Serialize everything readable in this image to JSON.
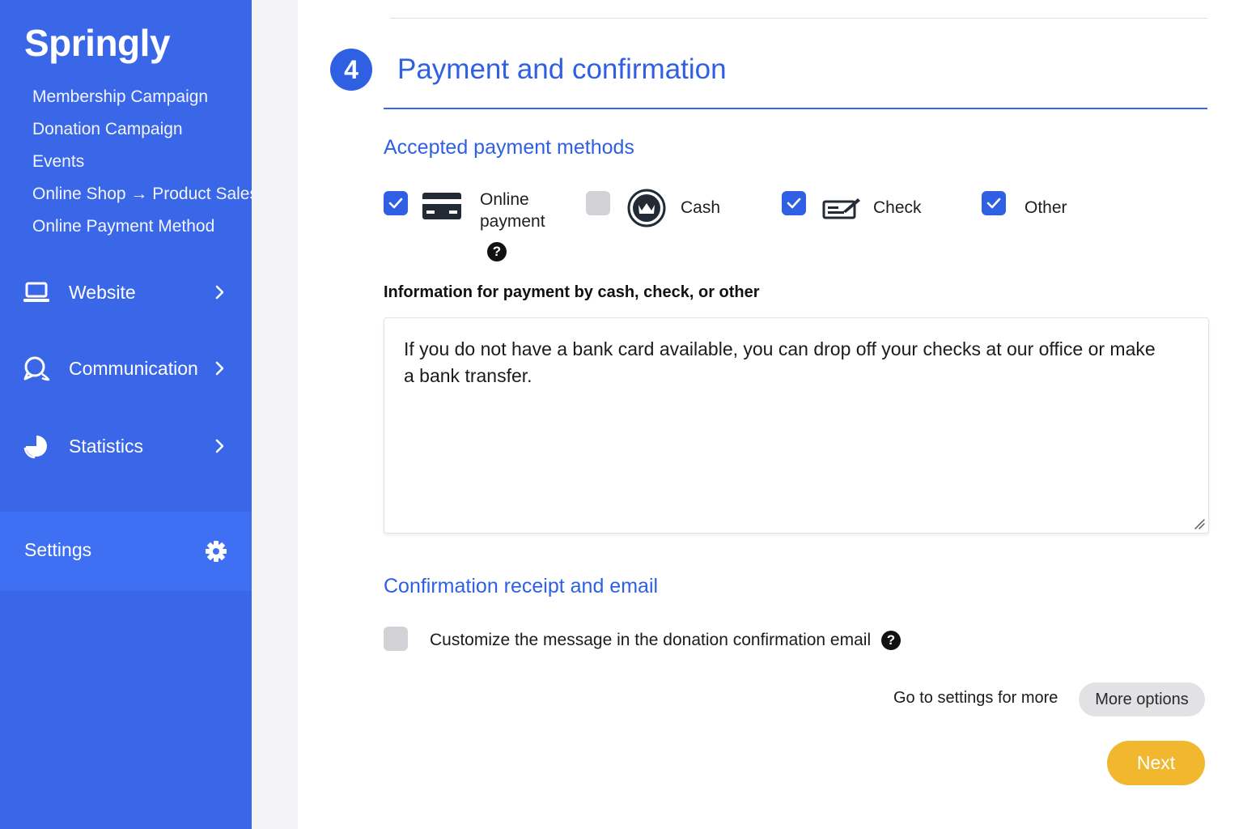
{
  "sidebar": {
    "brand": "Springly",
    "sub_links": [
      "Membership Campaign",
      "Donation Campaign",
      "Events",
      "Online Shop → Product Sales",
      "Online Payment Method"
    ],
    "nav": [
      {
        "label": "Website",
        "icon": "laptop-icon"
      },
      {
        "label": "Communication",
        "icon": "chat-bubbles-icon"
      },
      {
        "label": "Statistics",
        "icon": "pie-chart-icon"
      }
    ],
    "settings": {
      "label": "Settings",
      "icon": "gear-icon"
    }
  },
  "main": {
    "step_number": "4",
    "step_title": "Payment and confirmation",
    "payment_section_title": "Accepted payment methods",
    "payment_methods": [
      {
        "label_line1": "Online",
        "label_line2": "payment",
        "checked": true,
        "icon": "credit-card-icon"
      },
      {
        "label": "Cash",
        "checked": false,
        "icon": "cash-coin-icon"
      },
      {
        "label": "Check",
        "checked": true,
        "icon": "bank-check-icon"
      },
      {
        "label": "Other",
        "checked": true
      }
    ],
    "info_label": "Information for payment by cash, check, or other",
    "info_text": "If you do not have a bank card available, you can drop off your checks at our office or make a bank transfer.",
    "confirmation_section_title": "Confirmation receipt and email",
    "customize_label": "Customize the message in the donation confirmation email",
    "customize_checked": false,
    "help_glyph": "?",
    "settings_hint": "Go to settings for more",
    "more_options_label": "More options",
    "next_label": "Next"
  },
  "colors": {
    "sidebar": "#3a66e8",
    "accent": "#2f5fe3",
    "next_button": "#f0b72f"
  }
}
